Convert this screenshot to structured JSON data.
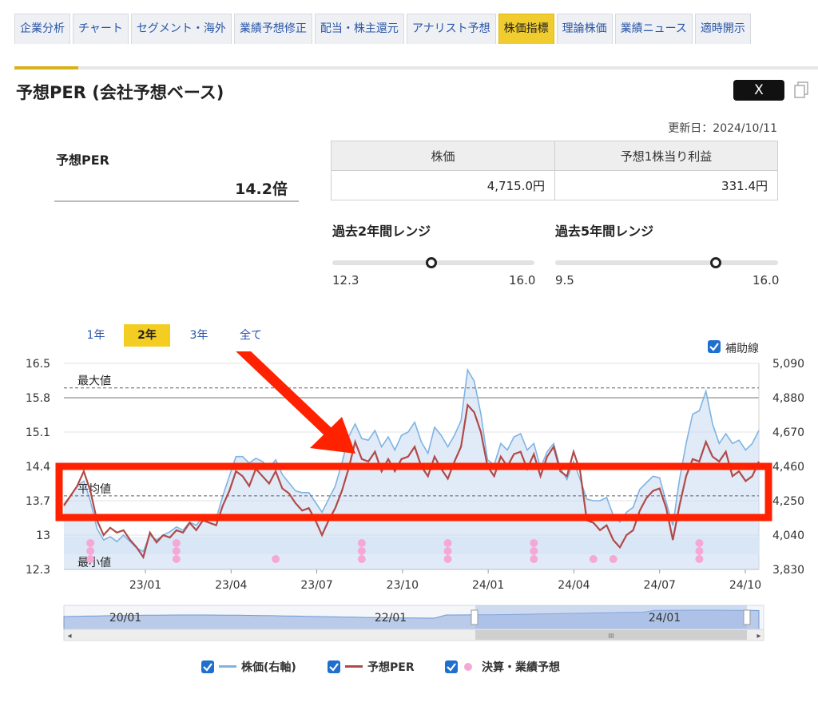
{
  "tabs": [
    "企業分析",
    "チャート",
    "セグメント・海外",
    "業績予想修正",
    "配当・株主還元",
    "アナリスト予想",
    "株価指標",
    "理論株価",
    "業績ニュース",
    "適時開示"
  ],
  "active_tab": "株価指標",
  "page_title": "予想PER (会社予想ベース)",
  "share_label": "X",
  "updated": "更新日：2024/10/11",
  "per": {
    "label": "予想PER",
    "value": "14.2倍"
  },
  "table": {
    "headers": [
      "株価",
      "予想1株当り利益"
    ],
    "values": [
      "4,715.0円",
      "331.4円"
    ]
  },
  "range2": {
    "title": "過去2年間レンジ",
    "min": "12.3",
    "max": "16.0",
    "position": 0.49
  },
  "range5": {
    "title": "過去5年間レンジ",
    "min": "9.5",
    "max": "16.0",
    "position": 0.72
  },
  "periods": [
    "1年",
    "2年",
    "3年",
    "全て"
  ],
  "active_period": "2年",
  "helper_line_label": "補助線",
  "legend": {
    "price": "株価(右軸)",
    "per": "予想PER",
    "events": "決算・業績予想"
  },
  "colors": {
    "price": "#7fb3e3",
    "per": "#b04a48",
    "event": "#f5a8d6",
    "highlight": "#ff2200",
    "tab_active": "#f1cc2e"
  },
  "chart_data": {
    "type": "line",
    "left_axis": {
      "ticks": [
        "16.5",
        "15.8",
        "15.1",
        "14.4",
        "13.7",
        "13",
        "12.3"
      ],
      "ylim": [
        12.3,
        16.5
      ]
    },
    "right_axis": {
      "ticks": [
        "5,090",
        "4,880",
        "4,670",
        "4,460",
        "4,250",
        "4,040",
        "3,830"
      ],
      "ylim": [
        3830,
        5090
      ]
    },
    "x_ticks": [
      "23/01",
      "23/04",
      "23/07",
      "23/10",
      "24/01",
      "24/04",
      "24/07",
      "24/10"
    ],
    "reference_lines": [
      {
        "label": "最大値",
        "value": 16.0
      },
      {
        "label": "平均値",
        "value": 13.8
      },
      {
        "label": "最小値",
        "value": 12.3
      }
    ],
    "series": [
      {
        "name": "予想PER",
        "axis": "left",
        "values": [
          13.6,
          13.8,
          14.0,
          14.3,
          13.9,
          13.3,
          13.0,
          13.15,
          13.05,
          13.1,
          12.9,
          12.75,
          12.55,
          13.05,
          12.85,
          13.0,
          12.95,
          13.1,
          13.05,
          13.25,
          13.1,
          13.3,
          13.25,
          13.2,
          13.6,
          13.9,
          14.3,
          14.2,
          14.0,
          14.35,
          14.2,
          14.05,
          14.3,
          13.95,
          13.85,
          13.65,
          13.5,
          13.55,
          13.3,
          13.0,
          13.3,
          13.55,
          13.9,
          14.35,
          14.9,
          14.55,
          14.5,
          14.7,
          14.3,
          14.55,
          14.3,
          14.55,
          14.6,
          14.8,
          14.4,
          14.2,
          14.6,
          14.35,
          14.15,
          14.5,
          14.8,
          15.65,
          15.5,
          15.1,
          14.4,
          14.2,
          14.6,
          14.4,
          14.65,
          14.7,
          14.35,
          14.65,
          14.2,
          14.6,
          14.8,
          14.3,
          14.2,
          14.7,
          14.3,
          13.3,
          13.25,
          13.1,
          13.2,
          12.9,
          12.75,
          13.0,
          13.1,
          13.5,
          13.75,
          13.9,
          13.95,
          13.55,
          12.9,
          13.6,
          14.2,
          14.55,
          14.5,
          14.9,
          14.6,
          14.5,
          14.7,
          14.2,
          14.3,
          14.1,
          14.2,
          14.5
        ]
      },
      {
        "name": "株価(右軸)",
        "axis": "right",
        "values": [
          4230,
          4280,
          4340,
          4370,
          4250,
          4080,
          4010,
          4030,
          4000,
          4040,
          4000,
          3960,
          3940,
          4040,
          4010,
          4040,
          4060,
          4090,
          4070,
          4120,
          4100,
          4150,
          4140,
          4140,
          4280,
          4400,
          4520,
          4520,
          4480,
          4510,
          4490,
          4450,
          4500,
          4410,
          4360,
          4310,
          4300,
          4300,
          4240,
          4180,
          4260,
          4340,
          4480,
          4640,
          4720,
          4630,
          4620,
          4680,
          4580,
          4640,
          4560,
          4650,
          4670,
          4730,
          4610,
          4540,
          4700,
          4650,
          4580,
          4650,
          4740,
          5050,
          4980,
          4780,
          4500,
          4470,
          4600,
          4560,
          4640,
          4660,
          4560,
          4600,
          4450,
          4550,
          4600,
          4450,
          4380,
          4490,
          4380,
          4260,
          4250,
          4250,
          4270,
          4160,
          4120,
          4180,
          4210,
          4320,
          4360,
          4400,
          4390,
          4240,
          4100,
          4380,
          4600,
          4780,
          4800,
          4920,
          4720,
          4600,
          4660,
          4600,
          4620,
          4560,
          4600,
          4680
        ]
      }
    ],
    "events": [
      {
        "x_index": 4,
        "count": 3
      },
      {
        "x_index": 17,
        "count": 3
      },
      {
        "x_index": 32,
        "count": 1
      },
      {
        "x_index": 45,
        "count": 3
      },
      {
        "x_index": 58,
        "count": 3
      },
      {
        "x_index": 71,
        "count": 3
      },
      {
        "x_index": 80,
        "count": 1
      },
      {
        "x_index": 83,
        "count": 1
      },
      {
        "x_index": 96,
        "count": 3
      }
    ],
    "navigator_x_ticks": [
      "20/01",
      "22/01",
      "24/01"
    ]
  }
}
